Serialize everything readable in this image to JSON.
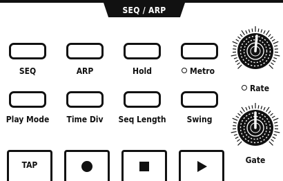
{
  "panel": {
    "title": "SEQ / ARP"
  },
  "buttons_row1": [
    "SEQ",
    "ARP",
    "Hold",
    "Metro"
  ],
  "buttons_row2": [
    "Play Mode",
    "Time Div",
    "Seq Length",
    "Swing"
  ],
  "transport": {
    "tap_label": "TAP"
  },
  "knobs": {
    "rate_label": "Rate",
    "gate_label": "Gate"
  },
  "icons": {
    "metro_indicator": "ring-icon",
    "rate_indicator": "ring-icon",
    "record": "record-icon",
    "stop": "stop-icon",
    "play": "play-icon"
  }
}
